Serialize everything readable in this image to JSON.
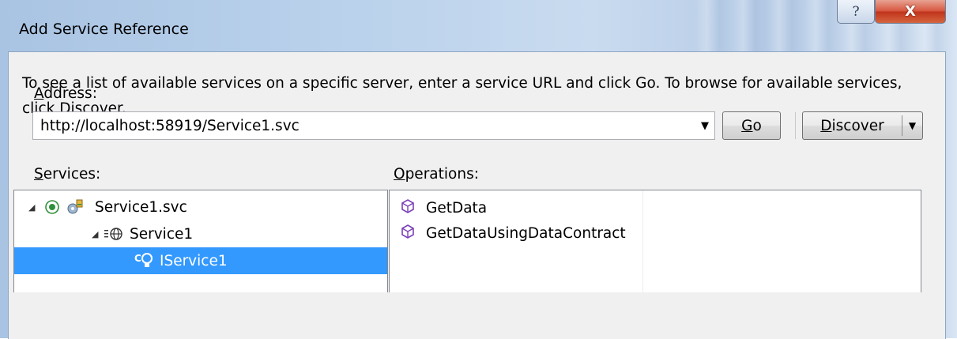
{
  "window": {
    "title": "Add Service Reference",
    "help_glyph": "?",
    "close_glyph": "X"
  },
  "instructions": "To see a list of available services on a specific server, enter a service URL and click Go. To browse for available services, click Discover.",
  "address": {
    "label_accel": "A",
    "label_rest": "ddress:",
    "value": "http://localhost:58919/Service1.svc",
    "dropdown_glyph": "▼"
  },
  "buttons": {
    "go_accel": "G",
    "go_rest": "o",
    "discover_accel": "D",
    "discover_rest": "iscover",
    "discover_arrow": "▼"
  },
  "services": {
    "label_accel": "S",
    "label_rest": "ervices:",
    "tree": [
      {
        "label": "Service1.svc",
        "icon": "service-file-icon",
        "expanded": true
      },
      {
        "label": "Service1",
        "icon": "service-globe-icon",
        "expanded": true
      },
      {
        "label": "IService1",
        "icon": "contract-interface-icon",
        "selected": true
      }
    ]
  },
  "operations": {
    "label_accel": "O",
    "label_rest": "perations:",
    "items": [
      {
        "label": "GetData",
        "icon": "operation-cube-icon"
      },
      {
        "label": "GetDataUsingDataContract",
        "icon": "operation-cube-icon"
      }
    ]
  },
  "colors": {
    "selection": "#3399ff",
    "operation_icon": "#7b3fb8",
    "close_button": "#c0341c"
  }
}
